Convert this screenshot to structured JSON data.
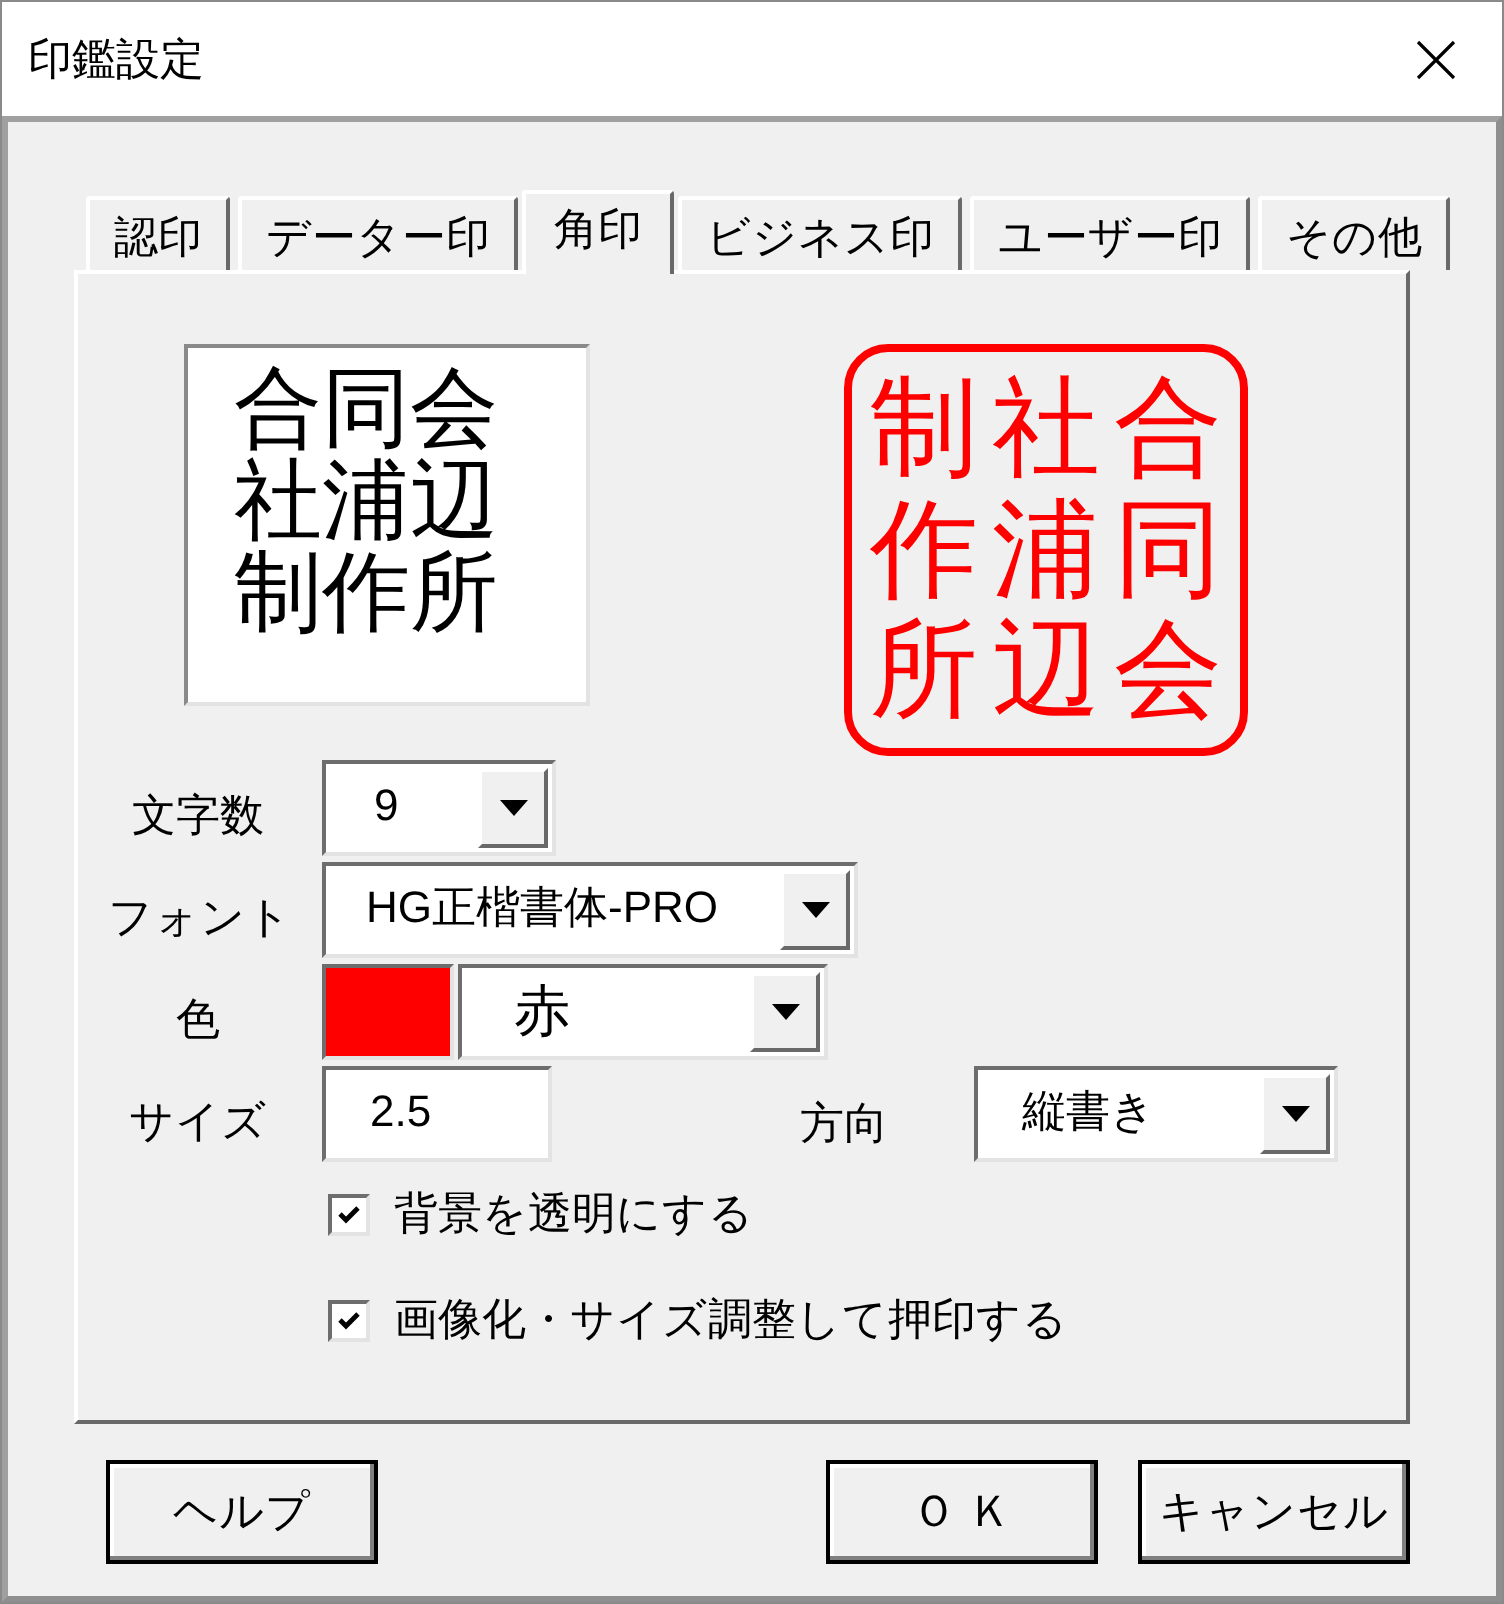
{
  "window": {
    "title": "印鑑設定"
  },
  "tabs": [
    {
      "label": "認印",
      "selected": false
    },
    {
      "label": "データー印",
      "selected": false
    },
    {
      "label": "角印",
      "selected": true
    },
    {
      "label": "ビジネス印",
      "selected": false
    },
    {
      "label": "ユーザー印",
      "selected": false
    },
    {
      "label": "その他",
      "selected": false
    }
  ],
  "preview": {
    "lines": [
      "合同会",
      "社浦辺",
      "制作所"
    ]
  },
  "seal": {
    "columns": [
      "制作所",
      "社浦辺",
      "合同会"
    ]
  },
  "char_count": {
    "label": "文字数",
    "value": "9"
  },
  "font": {
    "label": "フォント",
    "value": "HG正楷書体-PRO"
  },
  "color": {
    "label": "色",
    "color": "#ff0000",
    "value": "赤"
  },
  "size": {
    "label": "サイズ",
    "value": "2.5"
  },
  "direction": {
    "label": "方向",
    "value": "縦書き"
  },
  "checkboxes": [
    {
      "label": "背景を透明にする",
      "checked": true
    },
    {
      "label": "画像化・サイズ調整して押印する",
      "checked": true
    }
  ],
  "buttons": [
    "ヘルプ",
    "Ｏ Ｋ",
    "キャンセル"
  ]
}
